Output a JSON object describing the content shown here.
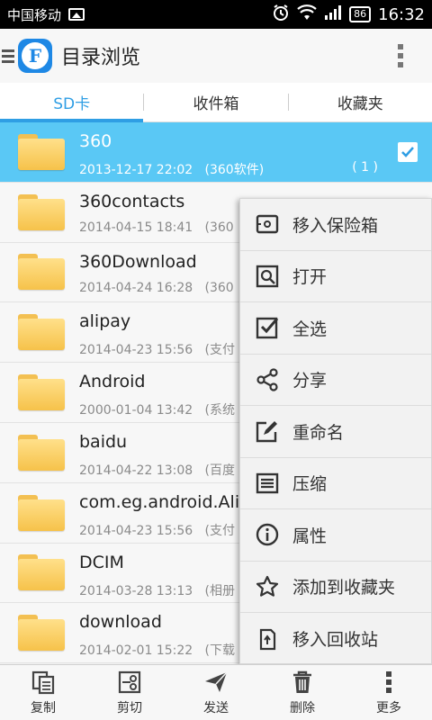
{
  "status_bar": {
    "carrier": "中国移动",
    "battery": "86",
    "time": "16:32"
  },
  "header": {
    "logo_letter": "F",
    "title": "目录浏览"
  },
  "tabs": [
    {
      "label": "SD卡",
      "active": true
    },
    {
      "label": "收件箱",
      "active": false
    },
    {
      "label": "收藏夹",
      "active": false
    }
  ],
  "files": [
    {
      "name": "360",
      "date": "2013-12-17 22:02",
      "category": "(360软件)",
      "count": "( 1 )",
      "selected": true
    },
    {
      "name": "360contacts",
      "date": "2014-04-15 18:41",
      "category": "(360"
    },
    {
      "name": "360Download",
      "date": "2014-04-24 16:28",
      "category": "(360"
    },
    {
      "name": "alipay",
      "date": "2014-04-23 15:56",
      "category": "(支付"
    },
    {
      "name": "Android",
      "date": "2000-01-04 13:42",
      "category": "(系统"
    },
    {
      "name": "baidu",
      "date": "2014-04-22 13:08",
      "category": "(百度"
    },
    {
      "name": "com.eg.android.Ali",
      "date": "2014-04-23 15:56",
      "category": "(支付"
    },
    {
      "name": "DCIM",
      "date": "2014-03-28 13:13",
      "category": "(相册"
    },
    {
      "name": "download",
      "date": "2014-02-01 15:22",
      "category": "(下载"
    }
  ],
  "context_menu": [
    {
      "label": "移入保险箱",
      "icon": "safe-icon"
    },
    {
      "label": "打开",
      "icon": "open-icon"
    },
    {
      "label": "全选",
      "icon": "select-all-icon"
    },
    {
      "label": "分享",
      "icon": "share-icon"
    },
    {
      "label": "重命名",
      "icon": "rename-icon"
    },
    {
      "label": "压缩",
      "icon": "compress-icon"
    },
    {
      "label": "属性",
      "icon": "info-icon"
    },
    {
      "label": "添加到收藏夹",
      "icon": "star-icon"
    },
    {
      "label": "移入回收站",
      "icon": "recycle-icon"
    }
  ],
  "toolbar": [
    {
      "label": "复制",
      "icon": "copy-icon"
    },
    {
      "label": "剪切",
      "icon": "cut-icon"
    },
    {
      "label": "发送",
      "icon": "send-icon"
    },
    {
      "label": "删除",
      "icon": "delete-icon"
    },
    {
      "label": "更多",
      "icon": "more-icon"
    }
  ],
  "colors": {
    "accent": "#2f9ee4",
    "selected_row": "#5ac8f5",
    "folder": "#f6c24a"
  }
}
